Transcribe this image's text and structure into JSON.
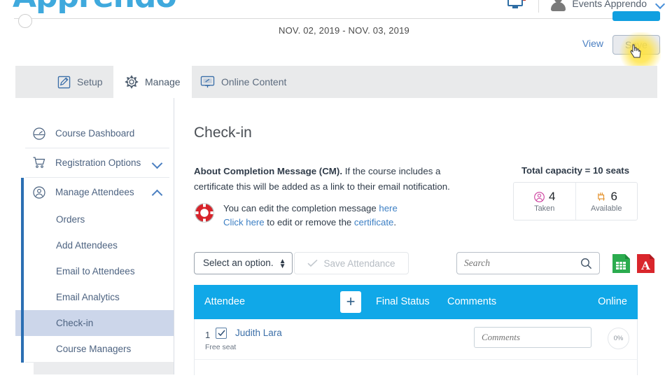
{
  "brand": {
    "logo_text": "Apprendo",
    "logo_color": "#3fa9dd"
  },
  "topbar": {
    "monitor_icon": "monitor-icon",
    "avatar_icon": "avatar-icon",
    "user_name": "Events Apprendo",
    "chevron_icon": "chevron-down-icon"
  },
  "header": {
    "date_range": "NOV. 02, 2019 - NOV. 03, 2019",
    "view_label": "View",
    "save_label": "Save"
  },
  "tabs": [
    {
      "label": "Setup",
      "icon": "pencil-square-icon",
      "active": false
    },
    {
      "label": "Manage",
      "icon": "gear-icon",
      "active": true
    },
    {
      "label": "Online Content",
      "icon": "monitor-content-icon",
      "active": false
    }
  ],
  "sidebar": {
    "items": [
      {
        "label": "Course Dashboard",
        "icon": "speedometer-icon",
        "type": "top"
      },
      {
        "label": "Registration Options",
        "icon": "cart-icon",
        "type": "top",
        "caret": "down"
      },
      {
        "label": "Manage Attendees",
        "icon": "attendee-icon",
        "type": "top",
        "caret": "up",
        "accent": true
      }
    ],
    "sub_items": [
      {
        "label": "Orders",
        "selected": false
      },
      {
        "label": "Add Attendees",
        "selected": false
      },
      {
        "label": "Email to Attendees",
        "selected": false
      },
      {
        "label": "Email Analytics",
        "selected": false
      },
      {
        "label": "Check-in",
        "selected": true
      },
      {
        "label": "Course Managers",
        "selected": false
      }
    ],
    "accent_color": "#2b6fb3",
    "selected_color": "#ccd6ea"
  },
  "main": {
    "page_title": "Check-in",
    "about": {
      "bold_lead": "About Completion Message (CM).",
      "rest": " If the course includes a certificate this will be added as a link to their email notification."
    },
    "note": {
      "icon": "lifesaver-icon",
      "line1_pre": "You can edit the completion message ",
      "line1_link": "here",
      "line2_link1": "Click here",
      "line2_mid": " to edit or remove the ",
      "line2_link2": "certificate",
      "line2_end": "."
    },
    "capacity": {
      "title": "Total capacity = 10 seats",
      "cells": [
        {
          "value": "4",
          "label": "Taken",
          "icon": "attendee-taken-icon",
          "color": "#cc3f9e"
        },
        {
          "value": "6",
          "label": "Available",
          "icon": "seat-available-icon",
          "color": "#e3922e"
        }
      ]
    },
    "toolbar": {
      "select_value": "Select an option.",
      "save_attendance_label": "Save Attendance",
      "check_icon": "check-icon",
      "search_placeholder": "Search",
      "search_value": "",
      "search_icon": "search-icon",
      "excel_icon": "excel-export-icon",
      "pdf_icon": "pdf-export-icon"
    },
    "table": {
      "header_color": "#10a8e8",
      "columns": [
        "Attendee",
        "Final Status",
        "Comments",
        "Online"
      ],
      "add_button_label": "+",
      "rows": [
        {
          "num": "1",
          "checked": true,
          "name": "Judith Lara",
          "sub": "Free seat",
          "comment_value": "",
          "comment_placeholder": "Comments",
          "final_status": "",
          "online_pct": "0%"
        }
      ]
    }
  }
}
